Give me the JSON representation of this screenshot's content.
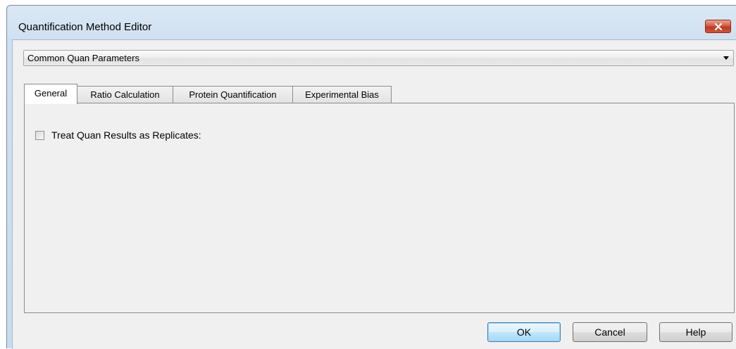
{
  "window": {
    "title": "Quantification Method Editor",
    "close_icon": "close-icon"
  },
  "combo": {
    "selected": "Common Quan Parameters"
  },
  "tabs": [
    {
      "label": "General",
      "active": true
    },
    {
      "label": "Ratio Calculation",
      "active": false
    },
    {
      "label": "Protein Quantification",
      "active": false
    },
    {
      "label": "Experimental Bias",
      "active": false
    }
  ],
  "general": {
    "treat_replicates_label": "Treat Quan Results as Replicates:",
    "treat_replicates_checked": false
  },
  "buttons": {
    "ok": "OK",
    "cancel": "Cancel",
    "help": "Help"
  },
  "colors": {
    "close_button": "#c9452b",
    "default_button_border": "#3c7fb1"
  }
}
